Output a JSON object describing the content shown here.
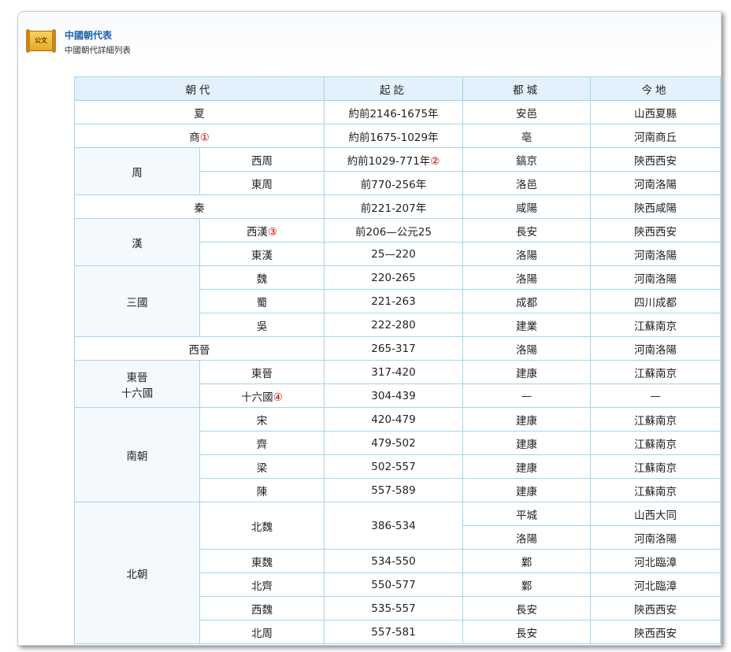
{
  "header": {
    "icon_text": "公文",
    "title": "中國朝代表",
    "subtitle": "中國朝代詳細列表"
  },
  "table": {
    "headers": [
      "朝代",
      "起訖",
      "都城",
      "今地"
    ],
    "rows": {
      "xia": {
        "dynasty": "夏",
        "period": "約前2146-1675年",
        "capital": "安邑",
        "today": "山西夏縣"
      },
      "shang": {
        "dynasty": "商",
        "note": "①",
        "period": "約前1675-1029年",
        "capital": "亳",
        "today": "河南商丘"
      },
      "zhou_group": "周",
      "xizhou": {
        "dynasty": "西周",
        "period": "約前1029-771年",
        "note": "②",
        "capital": "鎬京",
        "today": "陝西西安"
      },
      "dongzhou": {
        "dynasty": "東周",
        "period": "前770-256年",
        "capital": "洛邑",
        "today": "河南洛陽"
      },
      "qin": {
        "dynasty": "秦",
        "period": "前221-207年",
        "capital": "咸陽",
        "today": "陝西咸陽"
      },
      "han_group": "漢",
      "xihan": {
        "dynasty": "西漢",
        "note": "③",
        "period": "前206—公元25",
        "capital": "長安",
        "today": "陝西西安"
      },
      "donghan": {
        "dynasty": "東漢",
        "period": "25—220",
        "capital": "洛陽",
        "today": "河南洛陽"
      },
      "sanguo_group": "三國",
      "wei": {
        "dynasty": "魏",
        "period": "220-265",
        "capital": "洛陽",
        "today": "河南洛陽"
      },
      "shu": {
        "dynasty": "蜀",
        "period": "221-263",
        "capital": "成都",
        "today": "四川成都"
      },
      "wu": {
        "dynasty": "吳",
        "period": "222-280",
        "capital": "建業",
        "today": "江蘇南京"
      },
      "xijin": {
        "dynasty": "西晉",
        "period": "265-317",
        "capital": "洛陽",
        "today": "河南洛陽"
      },
      "dongjin_group_line1": "東晉",
      "dongjin_group_line2": "十六國",
      "dongjin": {
        "dynasty": "東晉",
        "period": "317-420",
        "capital": "建康",
        "today": "江蘇南京"
      },
      "shiliuguo": {
        "dynasty": "十六國",
        "note": "④",
        "period": "304-439",
        "capital": "—",
        "today": "—"
      },
      "nanchao_group": "南朝",
      "song": {
        "dynasty": "宋",
        "period": "420-479",
        "capital": "建康",
        "today": "江蘇南京"
      },
      "qi": {
        "dynasty": "齊",
        "period": "479-502",
        "capital": "建康",
        "today": "江蘇南京"
      },
      "liang": {
        "dynasty": "梁",
        "period": "502-557",
        "capital": "建康",
        "today": "江蘇南京"
      },
      "chen": {
        "dynasty": "陳",
        "period": "557-589",
        "capital": "建康",
        "today": "江蘇南京"
      },
      "beichao_group": "北朝",
      "beiwei": {
        "dynasty": "北魏",
        "period": "386-534",
        "capital1": "平城",
        "today1": "山西大同",
        "capital2": "洛陽",
        "today2": "河南洛陽"
      },
      "dongwei": {
        "dynasty": "東魏",
        "period": "534-550",
        "capital": "鄴",
        "today": "河北臨漳"
      },
      "beiqi": {
        "dynasty": "北齊",
        "period": "550-577",
        "capital": "鄴",
        "today": "河北臨漳"
      },
      "xiwei": {
        "dynasty": "西魏",
        "period": "535-557",
        "capital": "長安",
        "today": "陝西西安"
      },
      "beizhou": {
        "dynasty": "北周",
        "period": "557-581",
        "capital": "長安",
        "today": "陝西西安"
      }
    }
  }
}
